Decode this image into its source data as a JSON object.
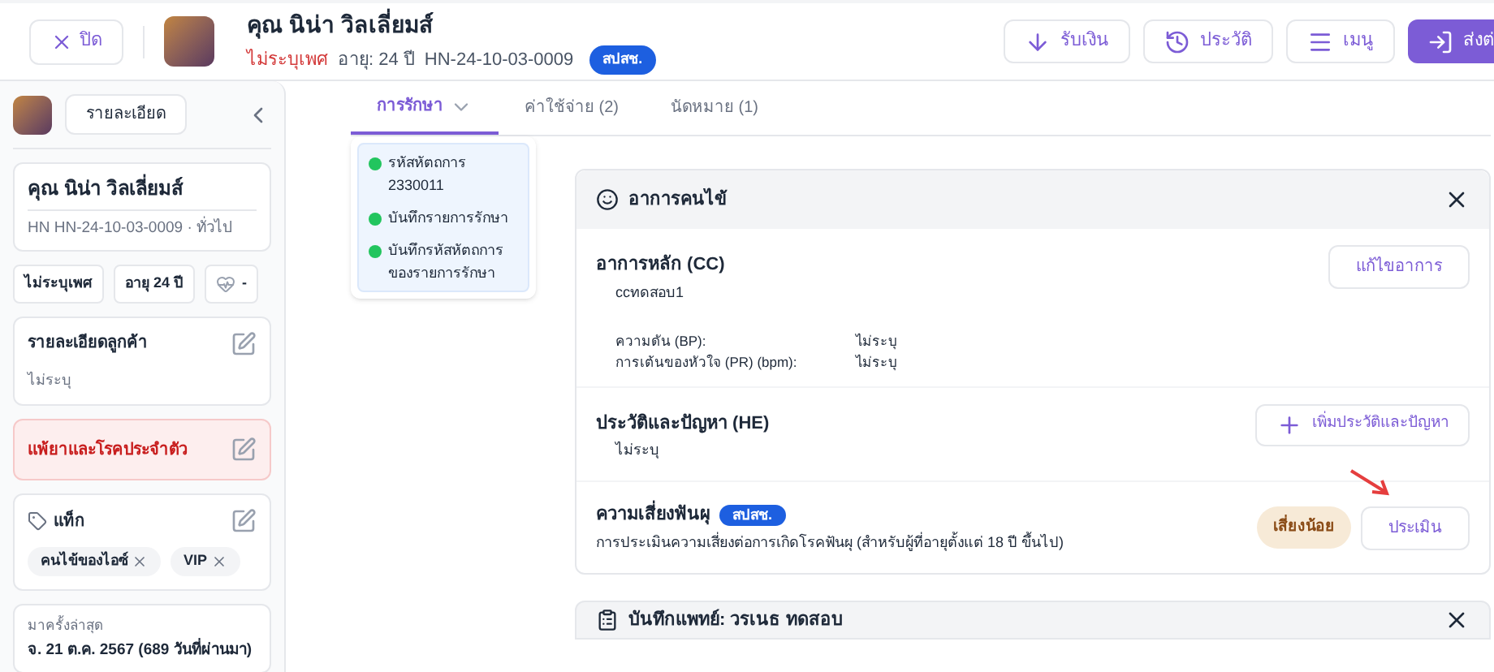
{
  "header": {
    "close_button": "ปิด",
    "patient_name": "คุณ นิน่า วิลเลี่ยมส์",
    "gender": "ไม่ระบุเพศ",
    "age": "อายุ: 24 ปี",
    "hn": "HN-24-10-03-0009",
    "badge": "สปสช.",
    "actions": [
      {
        "kind": "receive",
        "label": "รับเงิน"
      },
      {
        "kind": "history",
        "label": "ประวัติ"
      },
      {
        "kind": "menu",
        "label": "เมนู"
      },
      {
        "kind": "send",
        "label": "ส่งต่"
      }
    ]
  },
  "sidebar": {
    "details_button": "รายละเอียด",
    "name": "คุณ นิน่า วิลเลี่ยมส์",
    "hn_line": "HN HN-24-10-03-0009 · ทั่วไป",
    "chips": [
      "ไม่ระบุเพศ",
      "อายุ 24 ปี"
    ],
    "health_chip": "-",
    "customer_details": {
      "title": "รายละเอียดลูกค้า",
      "value": "ไม่ระบุ"
    },
    "allergy": {
      "title": "แพ้ยาและโรคประจำตัว"
    },
    "tags": {
      "title": "แท็ก",
      "items": [
        "คนไข้ของไอซ์",
        "VIP"
      ]
    },
    "last_visit": {
      "label": "มาครั้งล่าสุด",
      "value": "จ. 21 ต.ค. 2567 (689 วันที่ผ่านมา)"
    }
  },
  "tabs": [
    {
      "label": "การรักษา",
      "selected": true
    },
    {
      "label": "ค่าใช้จ่าย (2)",
      "selected": false
    },
    {
      "label": "นัดหมาย (1)",
      "selected": false
    }
  ],
  "timeline": [
    "รหัสหัตถการ 2330011",
    "บันทึกรายการรักษา",
    "บันทึกรหัสหัตถการของรายการรักษา"
  ],
  "symptoms_panel": {
    "title": "อาการคนไข้",
    "chief_complaint": {
      "title": "อาการหลัก (CC)",
      "button": "แก้ไขอาการ",
      "text": "ccทดสอบ1",
      "vitals": [
        {
          "label": "ความดัน (BP):",
          "value": "ไม่ระบุ"
        },
        {
          "label": "การเต้นของหัวใจ (PR) (bpm):",
          "value": "ไม่ระบุ"
        }
      ]
    },
    "history": {
      "title": "ประวัติและปัญหา (HE)",
      "button": "เพิ่มประวัติและปัญหา",
      "text": "ไม่ระบุ"
    },
    "dental_risk": {
      "title": "ความเสี่ยงฟันผุ",
      "badge": "สปสช.",
      "description": "การประเมินความเสี่ยงต่อการเกิดโรคฟันผุ (สำหรับผู้ที่อายุตั้งแต่ 18 ปี ขึ้นไป)",
      "risk_level": "เสี่ยงน้อย",
      "button": "ประเมิน"
    }
  },
  "doctor_panel": {
    "title": "บันทึกแพทย์: วรเนธ ทดสอบ"
  }
}
